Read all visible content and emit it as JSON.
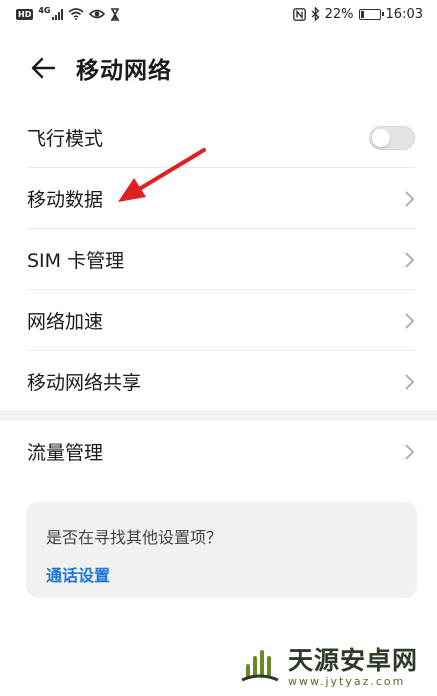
{
  "status_bar": {
    "hd_badge": "HD",
    "network_type": "4G",
    "battery_percent": "22%",
    "battery_level": 0.22,
    "time": "16:03",
    "icons": [
      "hd-icon",
      "signal-icon",
      "wifi-icon",
      "eye-icon",
      "hourglass-icon",
      "nfc-icon",
      "bluetooth-icon",
      "battery-icon"
    ]
  },
  "header": {
    "title": "移动网络",
    "back_icon": "back-arrow-icon"
  },
  "settings": {
    "items": [
      {
        "label": "飞行模式",
        "control": "toggle",
        "toggle_on": false
      },
      {
        "label": "移动数据",
        "control": "chevron"
      },
      {
        "label": "SIM 卡管理",
        "control": "chevron"
      },
      {
        "label": "网络加速",
        "control": "chevron"
      },
      {
        "label": "移动网络共享",
        "control": "chevron"
      }
    ],
    "flow_item": {
      "label": "流量管理",
      "control": "chevron"
    }
  },
  "hint": {
    "text": "是否在寻找其他设置项？",
    "link": "通话设置"
  },
  "colors": {
    "link": "#1b74d6",
    "annotation_arrow": "#e02020",
    "toggle_off": "#e4e4e4"
  },
  "watermark": {
    "cn": "天源安卓网",
    "url": "www.jytyaz.com"
  }
}
